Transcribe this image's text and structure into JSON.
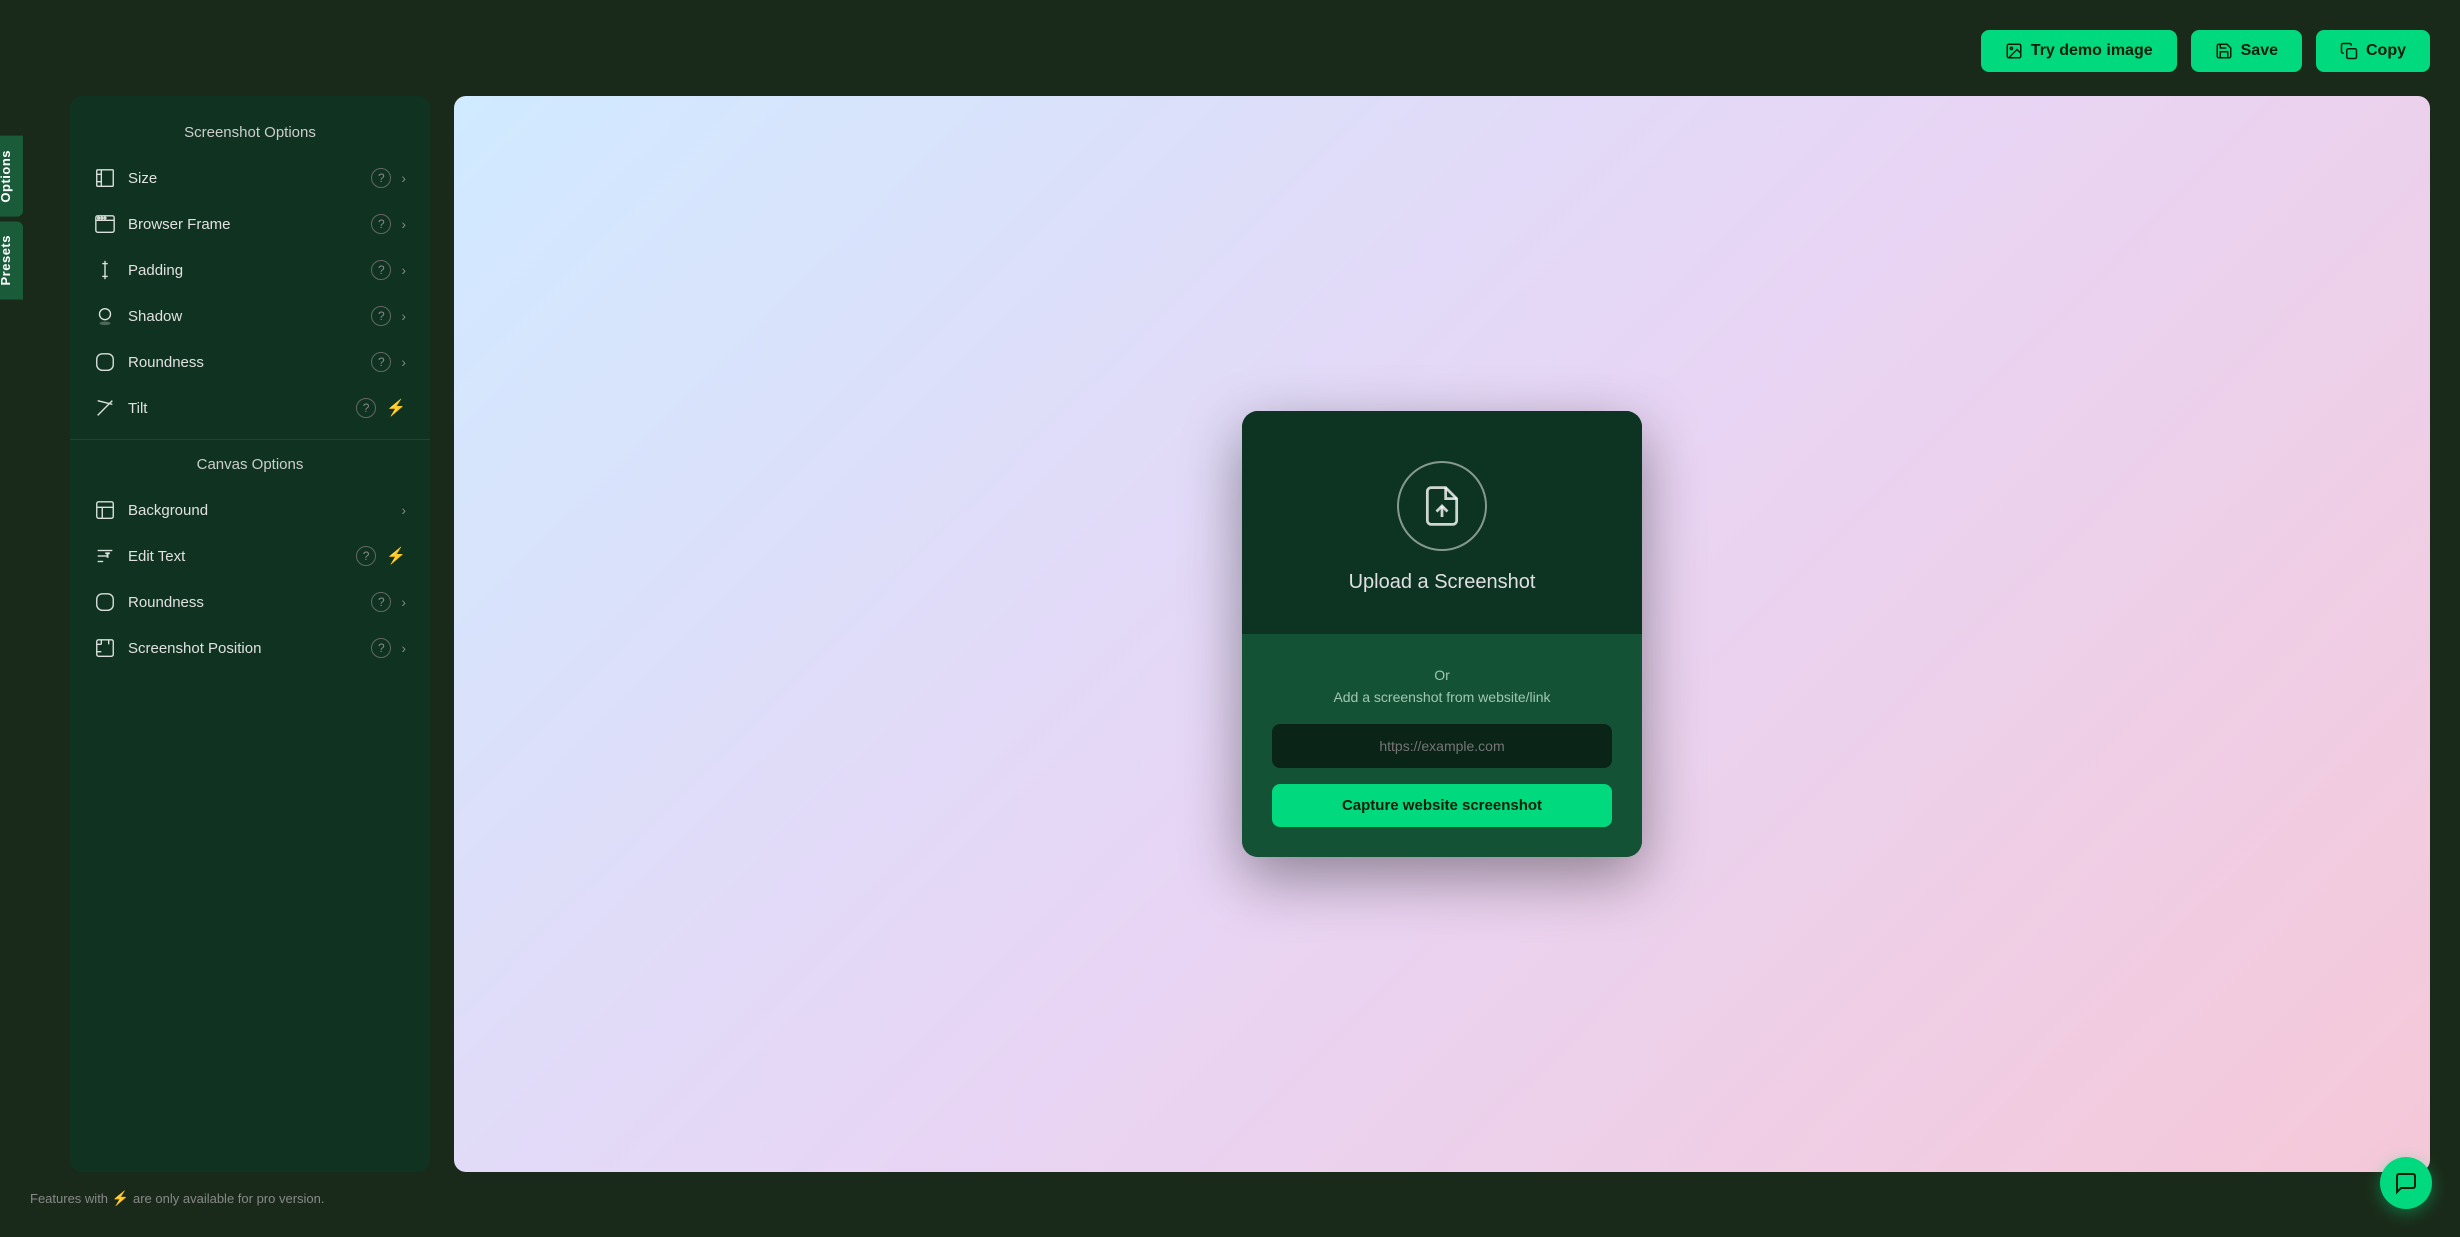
{
  "topbar": {
    "try_demo_label": "Try demo image",
    "save_label": "Save",
    "copy_label": "Copy"
  },
  "side_tabs": {
    "options_label": "Options",
    "presets_label": "Presets"
  },
  "sidebar": {
    "screenshot_options_title": "Screenshot Options",
    "canvas_options_title": "Canvas Options",
    "items": [
      {
        "id": "size",
        "label": "Size",
        "has_help": true,
        "has_chevron": true,
        "has_pro": false
      },
      {
        "id": "browser-frame",
        "label": "Browser Frame",
        "has_help": true,
        "has_chevron": true,
        "has_pro": false
      },
      {
        "id": "padding",
        "label": "Padding",
        "has_help": true,
        "has_chevron": true,
        "has_pro": false
      },
      {
        "id": "shadow",
        "label": "Shadow",
        "has_help": true,
        "has_chevron": true,
        "has_pro": false
      },
      {
        "id": "roundness",
        "label": "Roundness",
        "has_help": true,
        "has_chevron": true,
        "has_pro": false
      },
      {
        "id": "tilt",
        "label": "Tilt",
        "has_help": true,
        "has_chevron": false,
        "has_pro": true
      }
    ],
    "canvas_items": [
      {
        "id": "background",
        "label": "Background",
        "has_help": false,
        "has_chevron": true,
        "has_pro": false
      },
      {
        "id": "edit-text",
        "label": "Edit Text",
        "has_help": true,
        "has_chevron": false,
        "has_pro": true
      },
      {
        "id": "roundness-canvas",
        "label": "Roundness",
        "has_help": true,
        "has_chevron": true,
        "has_pro": false
      },
      {
        "id": "screenshot-position",
        "label": "Screenshot Position",
        "has_help": true,
        "has_chevron": true,
        "has_pro": false
      }
    ]
  },
  "upload_card": {
    "upload_title": "Upload a Screenshot",
    "or_text": "Or",
    "add_text": "Add a screenshot from website/link",
    "url_placeholder": "https://example.com",
    "capture_btn_label": "Capture website screenshot"
  },
  "bottom_note": {
    "text_before": "Features with",
    "text_after": "are only available for pro version."
  },
  "chat": {
    "icon_label": "chat-icon"
  },
  "colors": {
    "accent": "#00d97e",
    "pro": "#f5a623",
    "sidebar_bg": "#0f3320",
    "card_top": "#0d3322",
    "card_bottom": "#145235"
  }
}
